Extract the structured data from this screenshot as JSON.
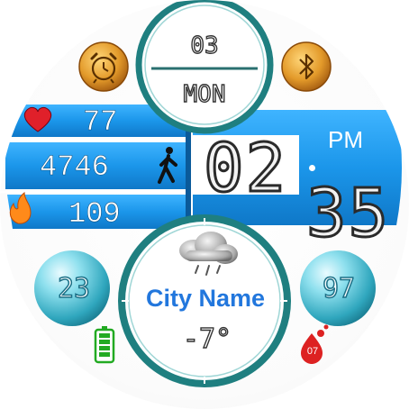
{
  "date": {
    "day_number": "03",
    "weekday": "MON"
  },
  "stats": {
    "heart_rate": "77",
    "steps": "4746",
    "calories": "109"
  },
  "time": {
    "hours": "02",
    "minutes": "35",
    "ampm": "PM"
  },
  "weather": {
    "city": "City Name",
    "temperature": "-7°",
    "icon": "cloud-rain-icon"
  },
  "left_ball": {
    "value": "23"
  },
  "right_ball": {
    "value": "97"
  },
  "blood_badge": {
    "value": "07"
  },
  "icons": {
    "alarm": "alarm-clock-icon",
    "bluetooth": "bluetooth-icon",
    "heart": "heart-icon",
    "walk": "walking-person-icon",
    "flame": "flame-icon",
    "battery": "battery-icon",
    "blood_drop": "blood-drop-icon"
  },
  "colors": {
    "band_blue": "#1e9cf0",
    "ring_teal": "#1f7f80",
    "ball_teal": "#4cc2d6",
    "gold": "#d28a22",
    "city_blue": "#2277dd",
    "battery_green": "#22aa22",
    "drop_red": "#dd2222"
  }
}
